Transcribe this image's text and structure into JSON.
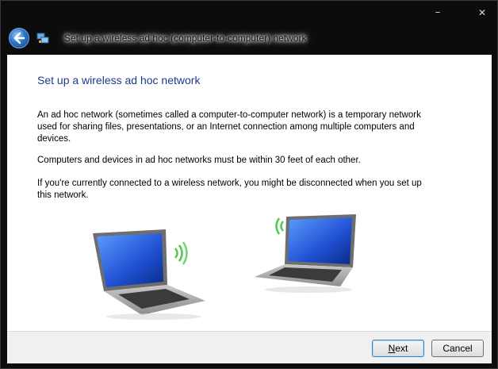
{
  "window": {
    "title": "Set up a wireless ad hoc (computer-to-computer) network",
    "minimize_glyph": "–",
    "close_glyph": "✕"
  },
  "content": {
    "heading": "Set up a wireless ad hoc network",
    "paragraphs": [
      "An ad hoc network (sometimes called a computer-to-computer network) is a temporary network used for sharing files, presentations, or an Internet connection among multiple computers and devices.",
      "Computers and devices in ad hoc networks must be within 30 feet of each other.",
      "If you're currently connected to a wireless network, you might be disconnected when you set up this network."
    ]
  },
  "buttons": {
    "next_first": "N",
    "next_rest": "ext",
    "cancel": "Cancel"
  },
  "icons": {
    "back": "back-arrow-icon",
    "wizard": "network-wizard-icon",
    "laptop_left": "laptop-wireless-icon",
    "laptop_right": "laptop-wireless-icon"
  },
  "colors": {
    "heading": "#1e3a8a",
    "footer": "#f0f0f0",
    "signal": "#4ec94e"
  }
}
